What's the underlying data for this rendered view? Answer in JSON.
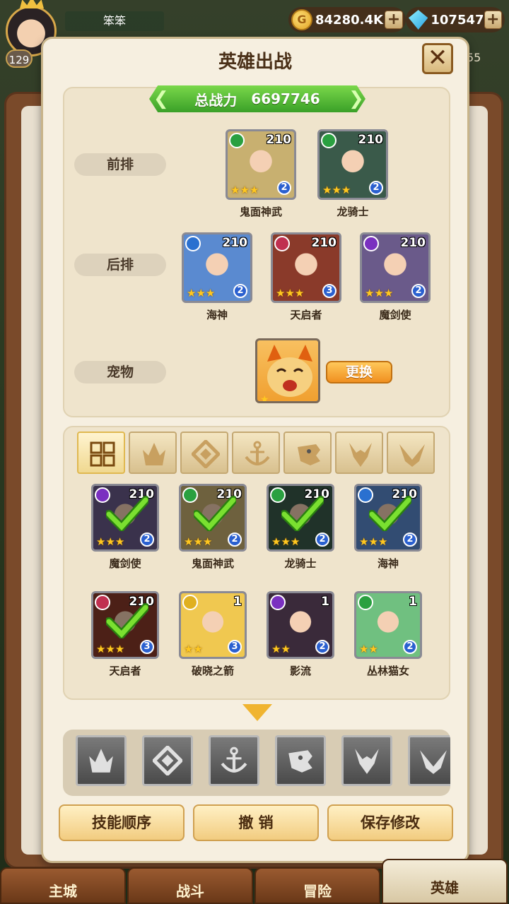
{
  "hud": {
    "player_name": "笨笨",
    "level": "129",
    "coins": "84280.4K",
    "gems": "107547",
    "side_number": "55"
  },
  "modal": {
    "title": "英雄出战",
    "close_label": "✕"
  },
  "lineup": {
    "power_label": "总战力",
    "power_value": "6697746",
    "front_label": "前排",
    "back_label": "后排",
    "pet_label": "宠物",
    "change_label": "更换",
    "front": [
      {
        "name": "鬼面神武",
        "level": "210",
        "grade": "2",
        "faction_color": "#2aa040",
        "faction_glyph": "beast",
        "tint": "#c8b070"
      },
      {
        "name": "龙骑士",
        "level": "210",
        "grade": "2",
        "faction_color": "#2aa040",
        "faction_glyph": "beast",
        "tint": "#3a5a4a"
      }
    ],
    "back": [
      {
        "name": "海神",
        "level": "210",
        "grade": "2",
        "faction_color": "#2a70d0",
        "faction_glyph": "anchor",
        "tint": "#5a8ad0"
      },
      {
        "name": "天启者",
        "level": "210",
        "grade": "3",
        "faction_color": "#c03050",
        "faction_glyph": "flame",
        "tint": "#8a3a2a"
      },
      {
        "name": "魔剑使",
        "level": "210",
        "grade": "2",
        "faction_color": "#7a30c0",
        "faction_glyph": "horn",
        "tint": "#6a5a8a"
      }
    ]
  },
  "roster": {
    "filters": [
      "all-filter-icon",
      "flame-faction-icon",
      "rune-faction-icon",
      "anchor-faction-icon",
      "beast-faction-icon",
      "horn-faction-icon",
      "wing-faction-icon"
    ],
    "heroes": [
      {
        "name": "魔剑使",
        "level": "210",
        "grade": "2",
        "selected": true,
        "faction_color": "#7a30c0",
        "tint": "#6a5a8a"
      },
      {
        "name": "鬼面神武",
        "level": "210",
        "grade": "2",
        "selected": true,
        "faction_color": "#2aa040",
        "tint": "#c8b070"
      },
      {
        "name": "龙骑士",
        "level": "210",
        "grade": "2",
        "selected": true,
        "faction_color": "#2aa040",
        "tint": "#3a5a4a"
      },
      {
        "name": "海神",
        "level": "210",
        "grade": "2",
        "selected": true,
        "faction_color": "#2a70d0",
        "tint": "#5a8ad0"
      },
      {
        "name": "天启者",
        "level": "210",
        "grade": "3",
        "selected": true,
        "faction_color": "#c03050",
        "tint": "#8a3a2a"
      },
      {
        "name": "破晓之箭",
        "level": "1",
        "grade": "3",
        "selected": false,
        "faction_color": "#e0b020",
        "tint": "#f0c850"
      },
      {
        "name": "影流",
        "level": "1",
        "grade": "2",
        "selected": false,
        "faction_color": "#7a30c0",
        "tint": "#3a2a3a"
      },
      {
        "name": "丛林猫女",
        "level": "1",
        "grade": "2",
        "selected": false,
        "faction_color": "#2aa040",
        "tint": "#70c080"
      }
    ]
  },
  "faction_strip": [
    "flame-faction-icon",
    "rune-faction-icon",
    "anchor-faction-icon",
    "beast-faction-icon",
    "horn-faction-icon",
    "wing-faction-icon"
  ],
  "actions": {
    "skill_order": "技能顺序",
    "cancel": "撤 销",
    "save": "保存修改"
  },
  "nav": {
    "main_city": "主城",
    "battle": "战斗",
    "adventure": "冒险",
    "heroes": "英雄"
  }
}
